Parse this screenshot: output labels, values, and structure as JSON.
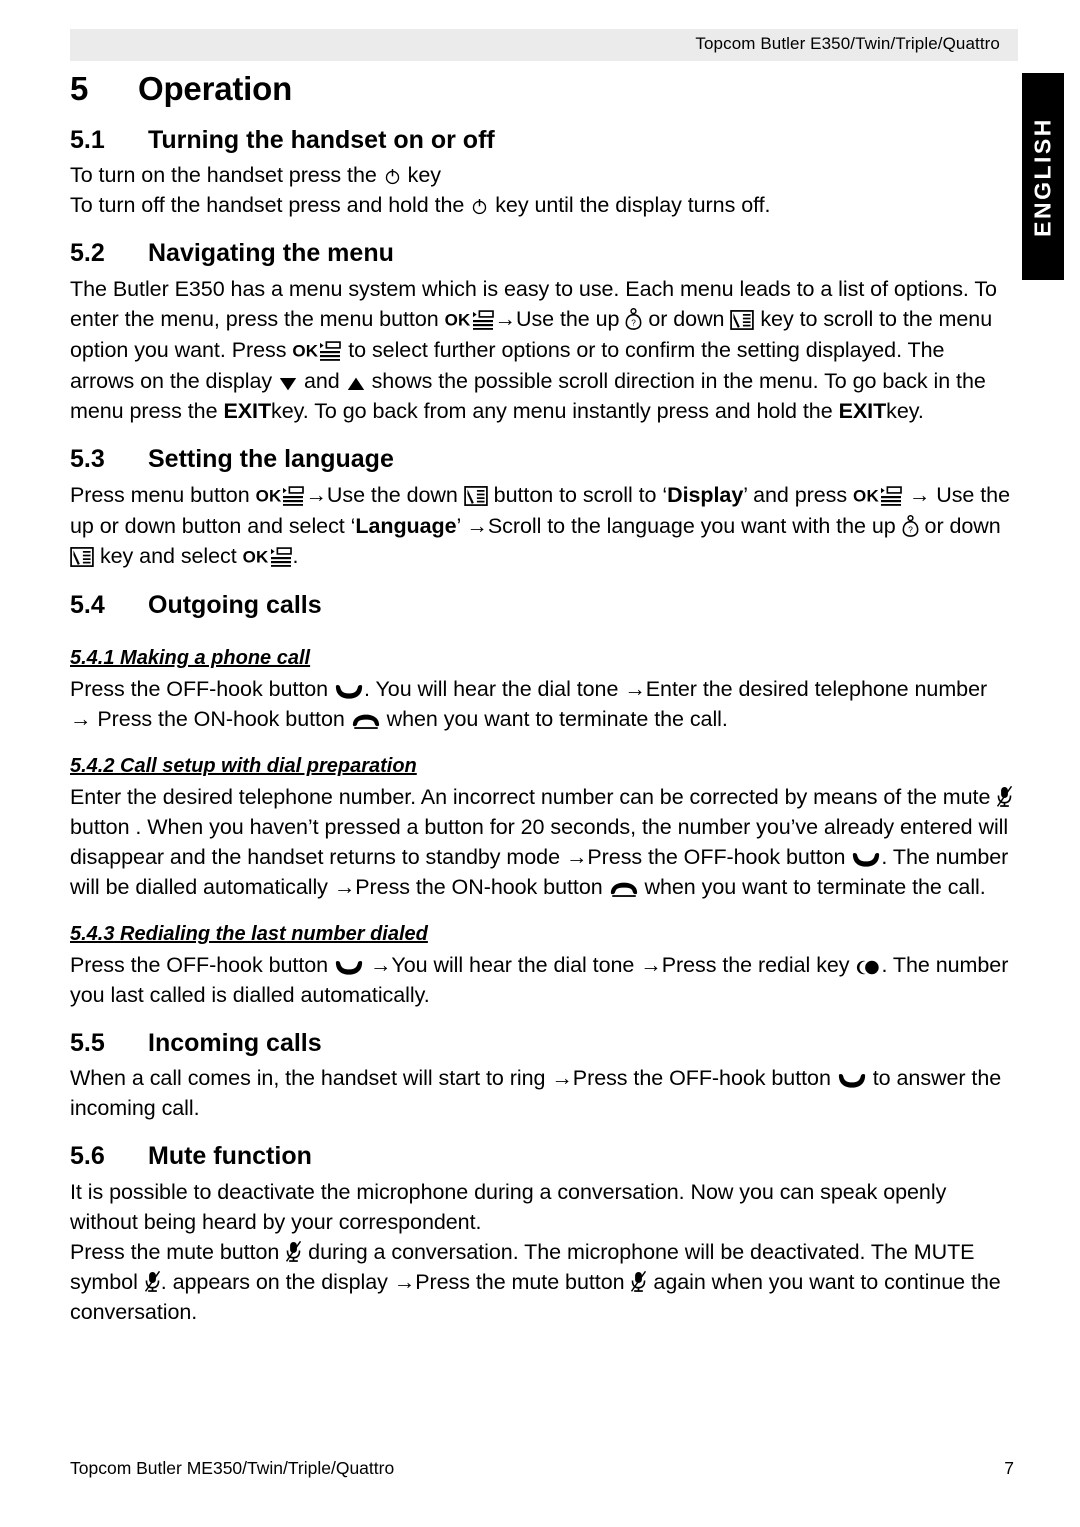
{
  "header": {
    "title": "Topcom Butler E350/Twin/Triple/Quattro",
    "band_color": "#ebebeb"
  },
  "side_tab": {
    "label": "ENGLISH",
    "background": "#000000",
    "text_color": "#ffffff"
  },
  "chapter": {
    "number": "5",
    "title": "Operation"
  },
  "sections": {
    "s51": {
      "number": "5.1",
      "title": "Turning the handset on or off",
      "line1_a": "To turn on the handset press the",
      "line1_b": "key",
      "line2_a": "To turn off the handset press and hold the",
      "line2_b": "key until the display turns off."
    },
    "s52": {
      "number": "5.2",
      "title": "Navigating the menu",
      "t1": "The Butler E350 has a menu system which is easy to use.  Each menu leads to a list of options. To enter the menu, press the menu button",
      "ok1": "OK",
      "t2": "Use the up",
      "t3": "or down",
      "t4": "key to scroll to the menu option you want.  Press",
      "ok2": "OK",
      "t5": "to select further options or to confirm the setting displayed. The arrows on the display",
      "t6": "and",
      "t7": "shows the possible scroll direction in the menu. To go back in the menu press the",
      "exit1": "EXIT",
      "t8": "key.  To go back from any menu instantly press and hold the",
      "exit2": "EXIT",
      "t9": "key."
    },
    "s53": {
      "number": "5.3",
      "title": "Setting the language",
      "t1": "Press menu button",
      "ok1": "OK",
      "t2": "Use the down",
      "t3": "button to scroll to ‘",
      "b1": "Display",
      "t4": "’ and press",
      "ok2": "OK",
      "t5": "Use the up or down button and select ‘",
      "b2": "Language",
      "t6": "’",
      "t7": "Scroll to the language you want with the up",
      "t8": "or down",
      "t9": "key and select",
      "ok3": "OK",
      "t10": "."
    },
    "s54": {
      "number": "5.4",
      "title": "Outgoing calls",
      "s541": {
        "number": "5.4.1",
        "title": "Making a phone call",
        "t1": "Press the OFF-hook button",
        "t2": ". You will hear the dial tone",
        "t3": "Enter the desired telephone number",
        "t4": "Press the ON-hook button",
        "t5": "when you want to terminate the call."
      },
      "s542": {
        "number": "5.4.2",
        "title": "Call setup with dial preparation",
        "t1": "Enter the desired telephone number. An incorrect number can be corrected by means of the mute",
        "t2": "button . When you haven’t pressed a button for 20 seconds, the number you’ve already entered will disappear and the handset returns to standby mode",
        "t3": "Press the OFF-hook button",
        "t4": ". The number will be dialled automatically",
        "t5": "Press the ON-hook button",
        "t6": "when you want to terminate the call."
      },
      "s543": {
        "number": "5.4.3",
        "title": "Redialing the last number dialed",
        "t1": "Press the OFF-hook button",
        "t2": "You will hear the dial tone",
        "t3": "Press the redial key",
        "t4": ". The number you last called is dialled automatically."
      }
    },
    "s55": {
      "number": "5.5",
      "title": "Incoming calls",
      "t1": "When a call comes in, the handset will start to ring",
      "t2": "Press the OFF-hook button",
      "t3": "to answer the incoming call."
    },
    "s56": {
      "number": "5.6",
      "title": "Mute function",
      "t1": "It is possible to deactivate the microphone during a conversation. Now you can speak openly without being heard by your correspondent.",
      "t2": "Press the mute button",
      "t3": "during a conversation. The microphone will be deactivated. The MUTE symbol",
      "t4": ". appears on the display",
      "t5": "Press the mute button",
      "t6": "again when you want to continue the conversation."
    }
  },
  "icons": {
    "power": "power-key-icon",
    "menu_ok": "menu-list-icon",
    "up": "phonebook-up-icon",
    "down": "list-down-icon",
    "arrow_down": "scroll-down-arrow-icon",
    "arrow_up": "scroll-up-arrow-icon",
    "off_hook": "off-hook-handset-icon",
    "on_hook": "on-hook-handset-icon",
    "mute": "mute-microphone-icon",
    "redial": "redial-key-icon",
    "arrow_right": "→"
  },
  "footer": {
    "left": "Topcom Butler ME350/Twin/Triple/Quattro",
    "page": "7"
  }
}
